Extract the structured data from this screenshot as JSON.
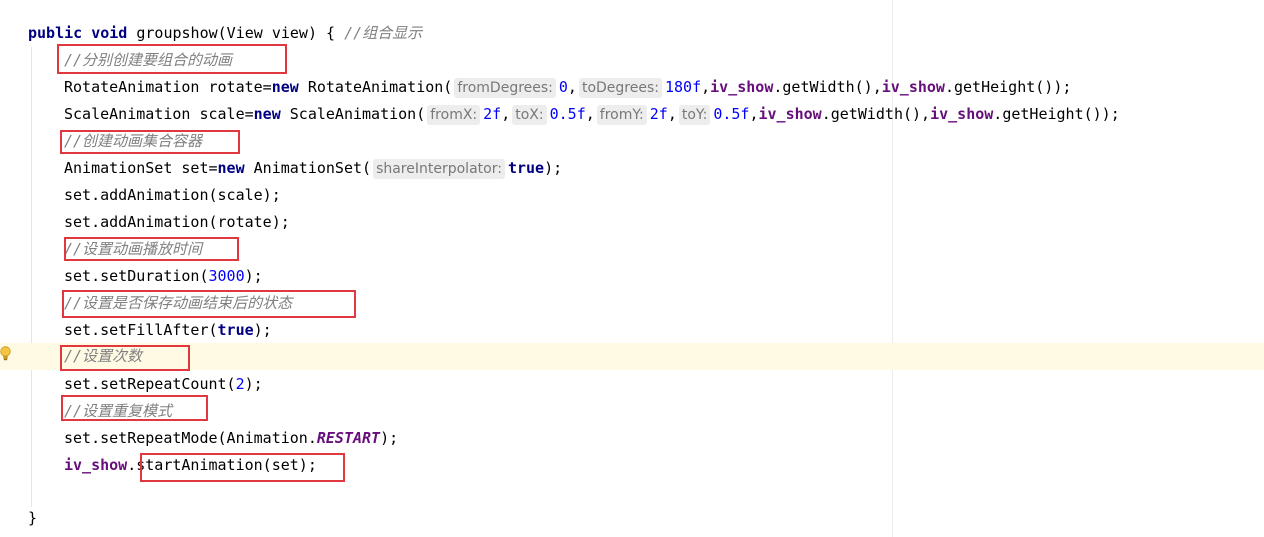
{
  "editor": {
    "method_sig": {
      "kw_public": "public",
      "kw_void": "void",
      "name": "groupshow(View view) {",
      "comment": "//组合显示"
    },
    "lines": [
      {
        "comment": "//分别创建要组合的动画"
      },
      {
        "t1": "RotateAnimation rotate=",
        "kw": "new",
        "t2": " RotateAnimation(",
        "h1": "fromDegrees:",
        "n1": "0",
        "sep1": ",",
        "h2": "toDegrees:",
        "n2": "180f",
        "sep2": ",",
        "f1": "iv_show",
        "t3": ".getWidth(),",
        "f2": "iv_show",
        "t4": ".getHeight());"
      },
      {
        "t1": "ScaleAnimation scale=",
        "kw": "new",
        "t2": " ScaleAnimation(",
        "h1": "fromX:",
        "n1": "2f",
        "sep1": ",",
        "h2": "toX:",
        "n2": "0.5f",
        "sep2": ",",
        "h3": "fromY:",
        "n3": "2f",
        "sep3": ",",
        "h4": "toY:",
        "n4": "0.5f",
        "sep4": ",",
        "f1": "iv_show",
        "t3": ".getWidth(),",
        "f2": "iv_show",
        "t4": ".getHeight());"
      },
      {
        "comment": "//创建动画集合容器"
      },
      {
        "t1": "AnimationSet set=",
        "kw": "new",
        "t2": " AnimationSet(",
        "h1": "shareInterpolator:",
        "kw2": "true",
        "t3": ");"
      },
      {
        "t1": "set.addAnimation(scale);"
      },
      {
        "t1": "set.addAnimation(rotate);"
      },
      {
        "comment": "//设置动画播放时间"
      },
      {
        "t1": "set.setDuration(",
        "n1": "3000",
        "t2": ");"
      },
      {
        "comment": "//设置是否保存动画结束后的状态"
      },
      {
        "t1": "set.setFillAfter(",
        "kw": "true",
        "t2": ");"
      },
      {
        "comment": "//设置次数"
      },
      {
        "t1": "set.setRepeatCount(",
        "n1": "2",
        "t2": ");"
      },
      {
        "comment": "//设置重复模式"
      },
      {
        "t1": "set.setRepeatMode(Animation.",
        "c1": "RESTART",
        "t2": ");"
      },
      {
        "f1": "iv_show",
        "t1": ".",
        "t2": "startAnimation(set);"
      }
    ],
    "closing_brace": "}"
  },
  "colors": {
    "keyword": "#000080",
    "comment": "#808080",
    "number": "#0000ff",
    "field": "#660e7a",
    "highlight_box": "#e0383e",
    "current_line": "#fffae3"
  },
  "icons": {
    "gutter": "lightbulb-icon"
  }
}
